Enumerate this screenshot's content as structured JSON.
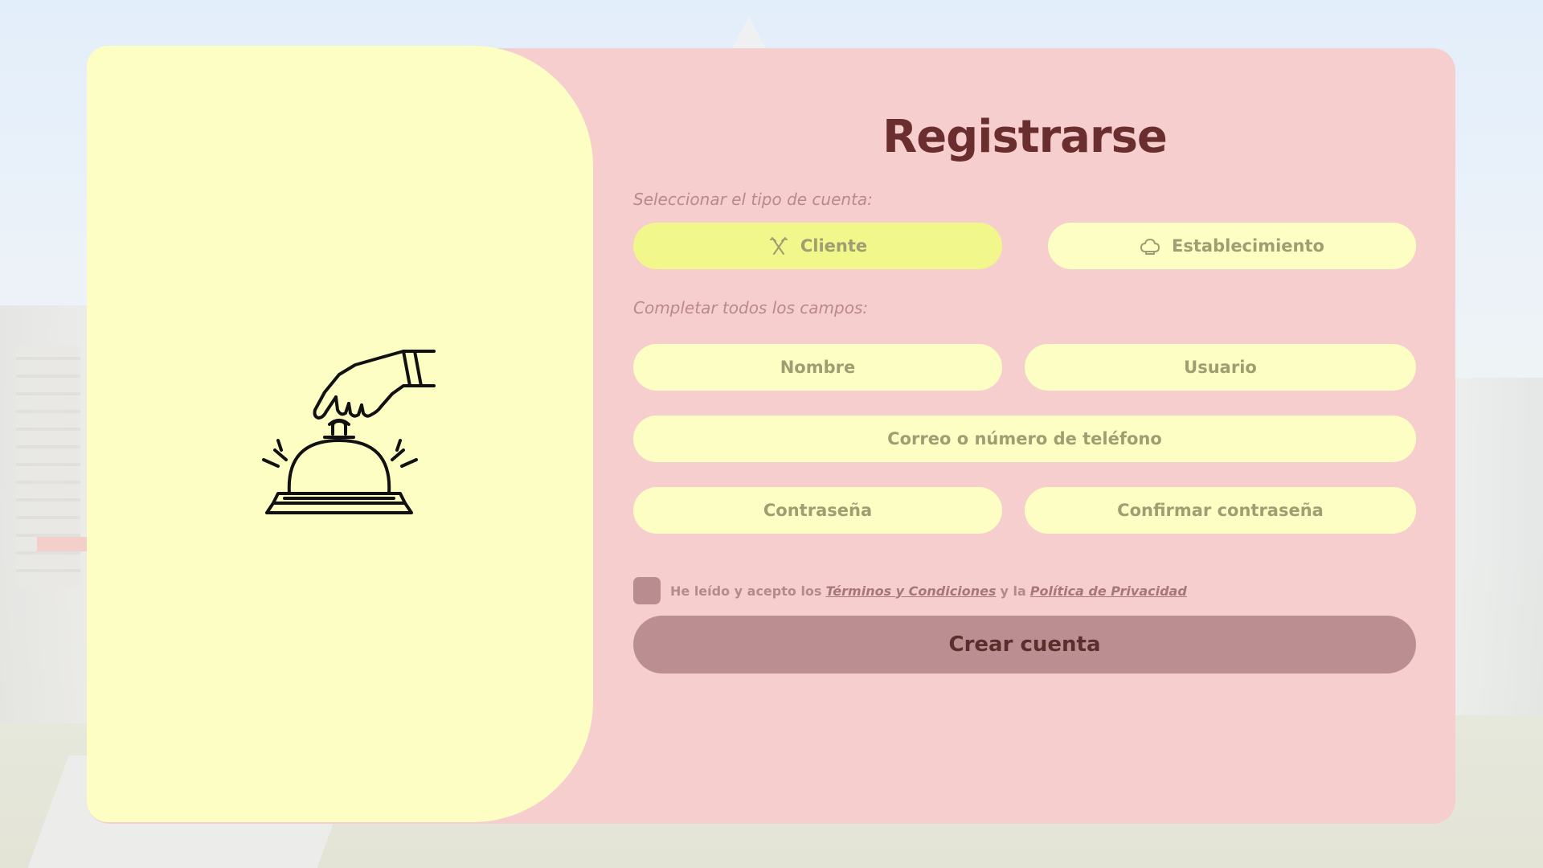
{
  "page": {
    "title": "Registrarse"
  },
  "account_type": {
    "label": "Seleccionar el tipo de cuenta:",
    "options": [
      {
        "label": "Cliente",
        "icon": "cutlery-icon",
        "selected": true
      },
      {
        "label": "Establecimiento",
        "icon": "chef-hat-icon",
        "selected": false
      }
    ]
  },
  "fields": {
    "label": "Completar todos los campos:",
    "name_placeholder": "Nombre",
    "user_placeholder": "Usuario",
    "contact_placeholder": "Correo o número de teléfono",
    "password_placeholder": "Contraseña",
    "confirm_placeholder": "Confirmar contraseña"
  },
  "terms": {
    "prefix": "He leído y acepto los",
    "terms_link": "Términos y Condiciones",
    "joiner": "y la",
    "privacy_link": "Política de Privacidad",
    "checked": false
  },
  "submit": {
    "label": "Crear cuenta"
  },
  "illustration": {
    "icon": "service-bell-icon"
  },
  "colors": {
    "card": "#f6cece",
    "left_panel": "#fdfec3",
    "field": "#fdfec3",
    "selected_option": "#f1f78a",
    "title": "#6b2e2e",
    "submit": "#bb8f91"
  }
}
